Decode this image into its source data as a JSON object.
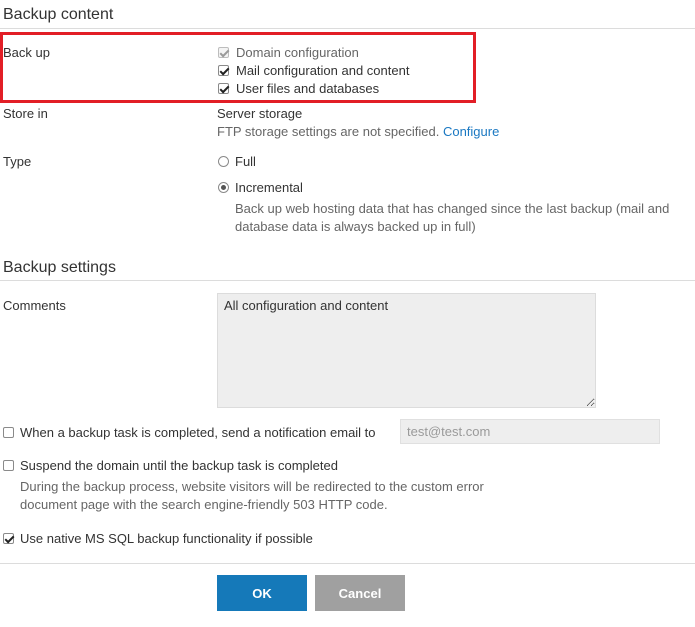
{
  "backup_content": {
    "title": "Backup content",
    "back_up_label": "Back up",
    "items": [
      {
        "label": "Domain configuration",
        "checked": true,
        "disabled": true
      },
      {
        "label": "Mail configuration and content",
        "checked": true,
        "disabled": false
      },
      {
        "label": "User files and databases",
        "checked": true,
        "disabled": false
      }
    ],
    "store_in_label": "Store in",
    "store_value": "Server storage",
    "ftp_note": "FTP storage settings are not specified.",
    "configure_link": "Configure",
    "type_label": "Type",
    "type_full": "Full",
    "type_incremental": "Incremental",
    "type_selected": "incremental",
    "incremental_note_line1": "Back up web hosting data that has changed since the last backup (mail and",
    "incremental_note_line2": "database data is always backed up in full)"
  },
  "backup_settings": {
    "title": "Backup settings",
    "comments_label": "Comments",
    "comments_value": "All configuration and content",
    "notify_label": "When a backup task is completed, send a notification email to",
    "notify_checked": false,
    "email_placeholder": "test@test.com",
    "suspend_label": "Suspend the domain until the backup task is completed",
    "suspend_checked": false,
    "suspend_note_line1": "During the backup process, website visitors will be redirected to the custom error",
    "suspend_note_line2": "document page with the search engine-friendly 503 HTTP code.",
    "mssql_label": "Use native MS SQL backup functionality if possible",
    "mssql_checked": true
  },
  "buttons": {
    "ok": "OK",
    "cancel": "Cancel",
    "ok_color": "#1579b9",
    "cancel_color": "#a0a0a0"
  },
  "highlight_color": "#e21e26"
}
